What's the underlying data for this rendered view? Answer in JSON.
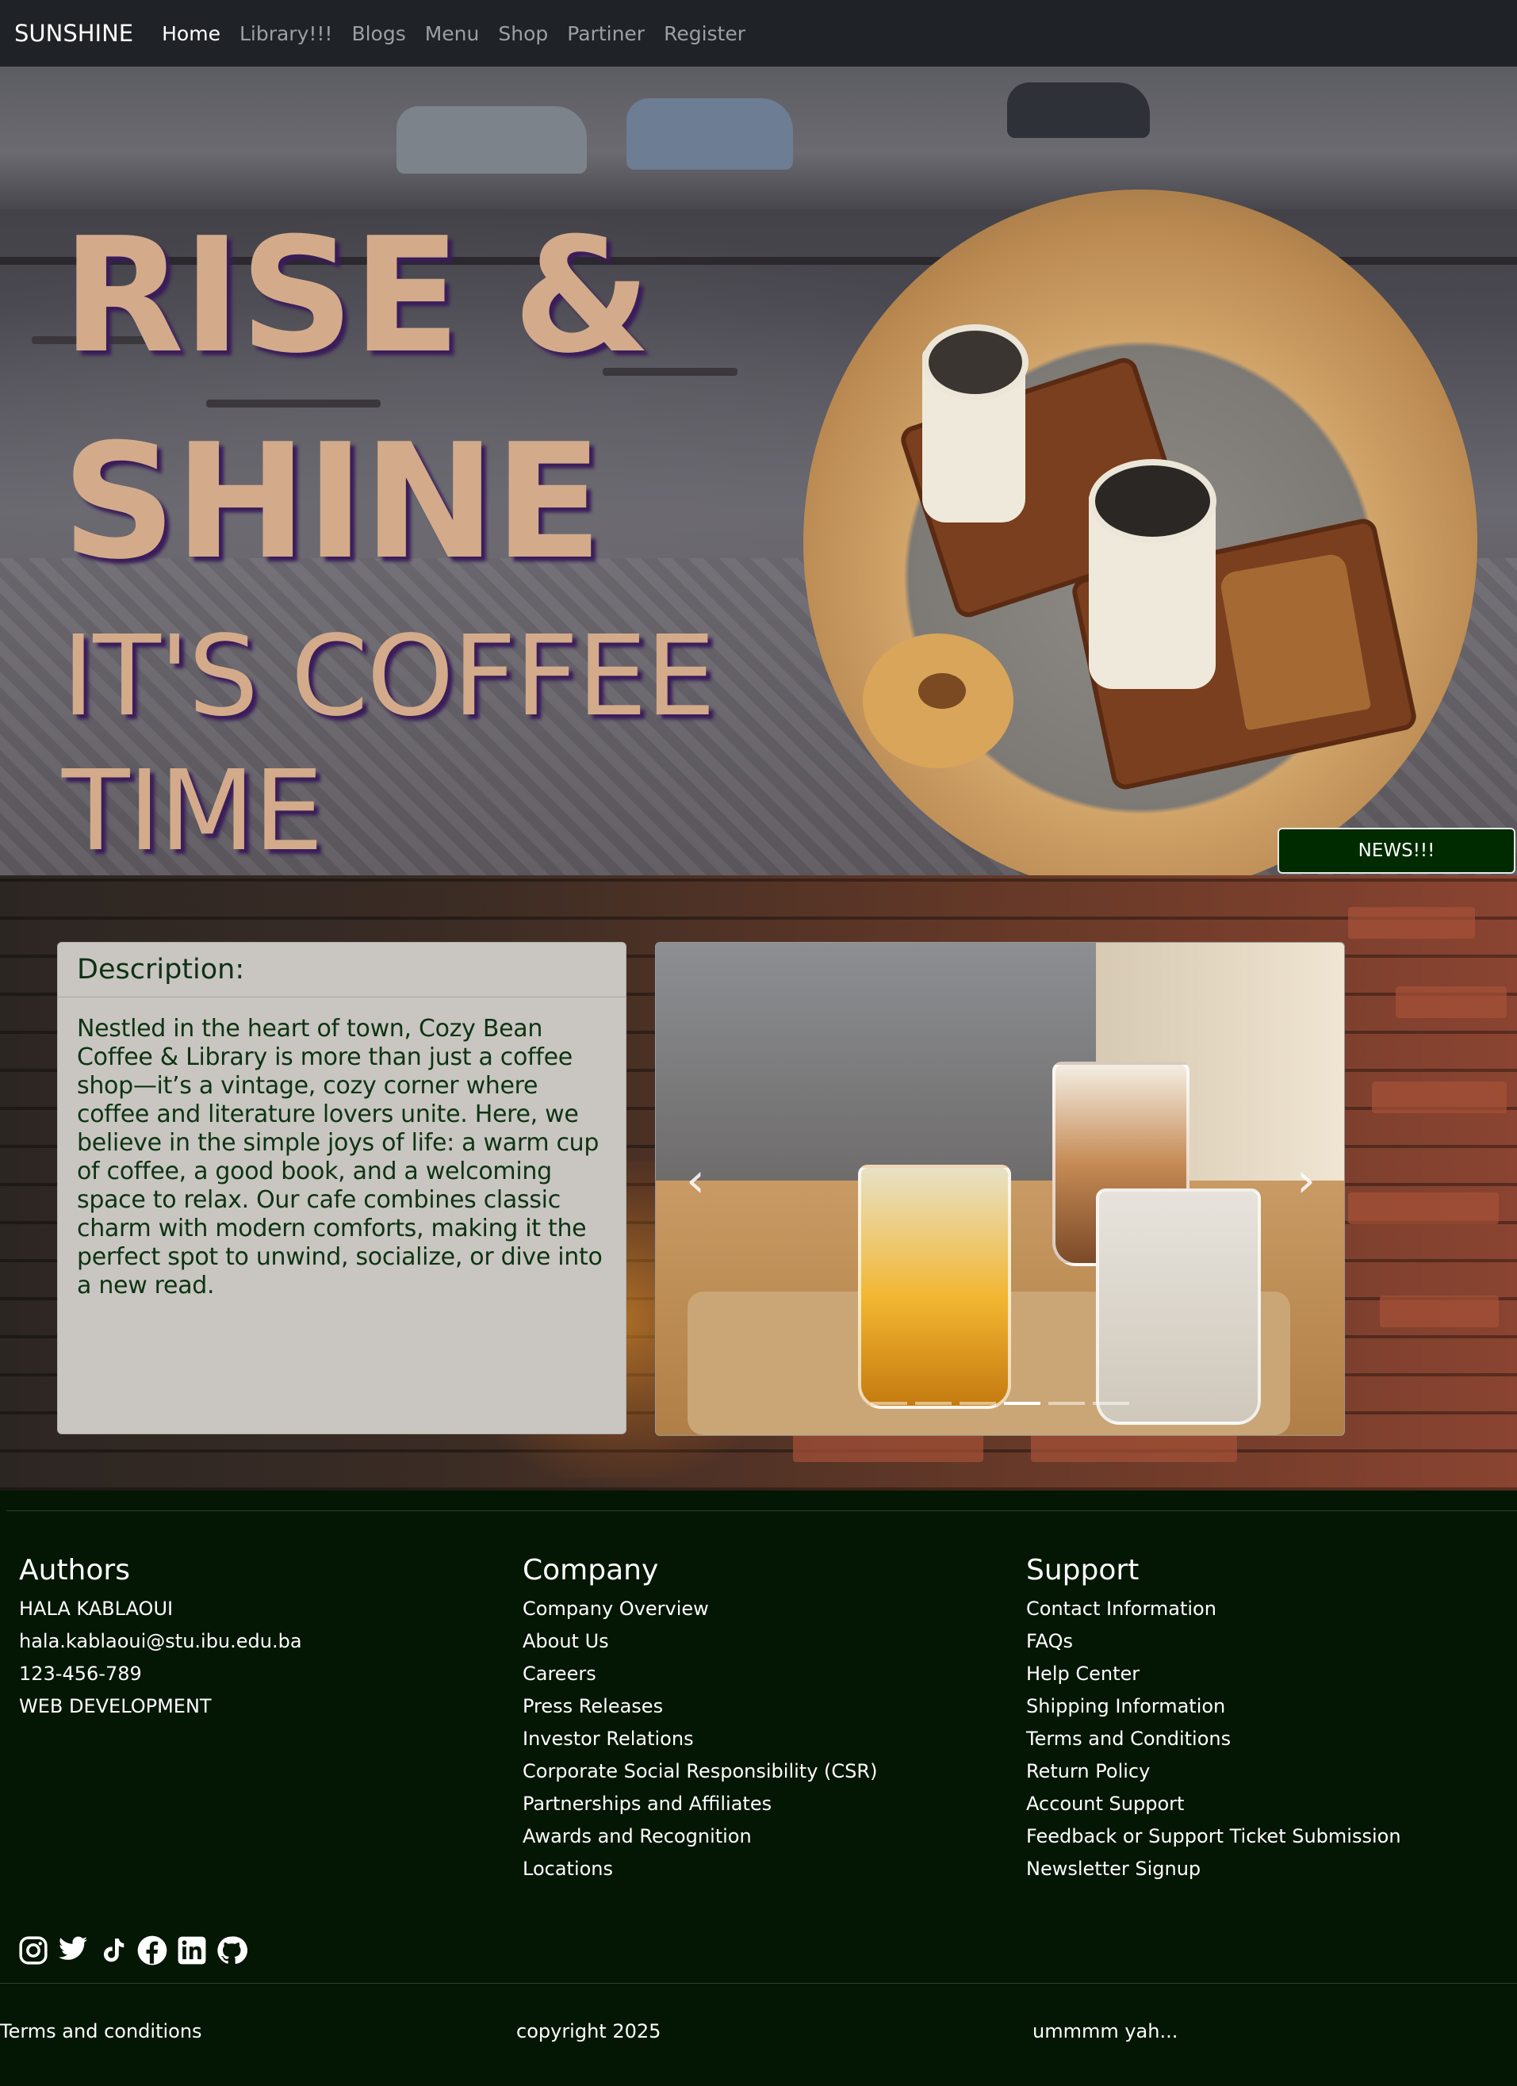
{
  "navbar": {
    "brand": "SUNSHINE",
    "links": [
      "Home",
      "Library!!!",
      "Blogs",
      "Menu",
      "Shop",
      "Partiner",
      "Register"
    ],
    "active": "Home"
  },
  "hero": {
    "line1": "RISE &",
    "line2": "SHINE",
    "line3": "IT'S COFFEE",
    "line4": "TIME",
    "news_button": "NEWS!!!"
  },
  "description": {
    "title": "Description:",
    "body": "Nestled in the heart of town, Cozy Bean Coffee & Library is more than just a coffee shop—it’s a vintage, cozy corner where coffee and literature lovers unite. Here, we believe in the simple joys of life: a warm cup of coffee, a good book, and a welcoming space to relax. Our cafe combines classic charm with modern comforts, making it the perfect spot to unwind, socialize, or dive into a new read."
  },
  "carousel": {
    "slide_count": 6,
    "active_index": 3
  },
  "footer": {
    "authors": {
      "title": "Authors",
      "items": [
        "HALA KABLAOUI",
        "hala.kablaoui@stu.ibu.edu.ba",
        "123-456-789",
        "WEB DEVELOPMENT"
      ]
    },
    "company": {
      "title": "Company",
      "items": [
        "Company Overview",
        "About Us",
        "Careers",
        "Press Releases",
        "Investor Relations",
        "Corporate Social Responsibility (CSR)",
        "Partnerships and Affiliates",
        "Awards and Recognition",
        "Locations"
      ]
    },
    "support": {
      "title": "Support",
      "items": [
        "Contact Information",
        "FAQs",
        "Help Center",
        "Shipping Information",
        "Terms and Conditions",
        "Return Policy",
        "Account Support",
        "Feedback or Support Ticket Submission",
        "Newsletter Signup"
      ]
    },
    "social_icons": [
      "instagram-icon",
      "twitter-icon",
      "tiktok-icon",
      "facebook-icon",
      "linkedin-icon",
      "github-icon"
    ],
    "bottom": {
      "left": "Terms and conditions",
      "center": "copyright 2025",
      "right": "ummmm yah..."
    }
  },
  "colors": {
    "navbar_bg": "#1f2227",
    "hero_text": "#d3ab8b",
    "hero_shadow": "#3a1d5a",
    "footer_bg": "#041604",
    "news_button_bg": "#002a00",
    "card_bg": "#c9c6c1",
    "card_text": "#0d3313"
  }
}
